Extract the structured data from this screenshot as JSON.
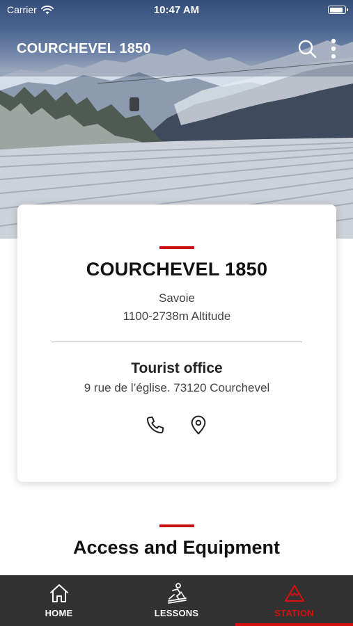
{
  "status_bar": {
    "carrier": "Carrier",
    "time": "10:47 AM"
  },
  "app_bar": {
    "title": "COURCHEVEL 1850",
    "icons": [
      "search-icon",
      "more-vertical-icon"
    ]
  },
  "resort_card": {
    "name": "COURCHEVEL 1850",
    "region": "Savoie",
    "altitude": "1100-2738m Altitude",
    "office_title": "Tourist office",
    "office_address": "9 rue de l’église. 73120 Courchevel",
    "actions": [
      "phone-icon",
      "location-pin-icon"
    ]
  },
  "section": {
    "title": "Access and Equipment"
  },
  "bottom_nav": {
    "items": [
      {
        "label": "HOME",
        "icon": "home-icon",
        "active": false
      },
      {
        "label": "LESSONS",
        "icon": "skier-icon",
        "active": false
      },
      {
        "label": "STATION",
        "icon": "mountain-icon",
        "active": true
      }
    ]
  },
  "colors": {
    "accent": "#c81414",
    "nav_background": "#323232",
    "active_tab": "#d31010"
  }
}
